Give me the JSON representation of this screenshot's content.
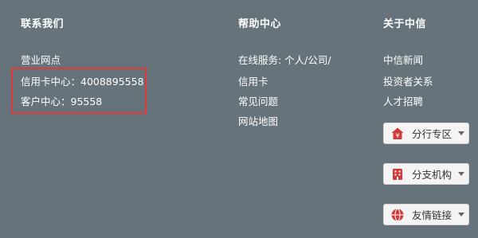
{
  "contact": {
    "title": "联系我们",
    "outlets": "营业网点",
    "credit_card": "信用卡中心：4008895558",
    "customer": "客户中心：95558"
  },
  "help": {
    "title": "帮助中心",
    "online_service_line1": "在线服务: 个人/公司/",
    "online_service_line2": "信用卡",
    "faq": "常见问题",
    "sitemap": "网站地图"
  },
  "about": {
    "title": "关于中信",
    "news": "中信新闻",
    "investor": "投资者关系",
    "careers": "人才招聘"
  },
  "dropdowns": [
    {
      "label": "分行专区",
      "icon": "yuan-house-icon",
      "color": "#d23a3a"
    },
    {
      "label": "分支机构",
      "icon": "building-icon",
      "color": "#d23a3a"
    },
    {
      "label": "友情链接",
      "icon": "globe-icon",
      "color": "#d23a3a"
    }
  ],
  "highlight_color": "#e03a3a",
  "background_color": "#66737a"
}
